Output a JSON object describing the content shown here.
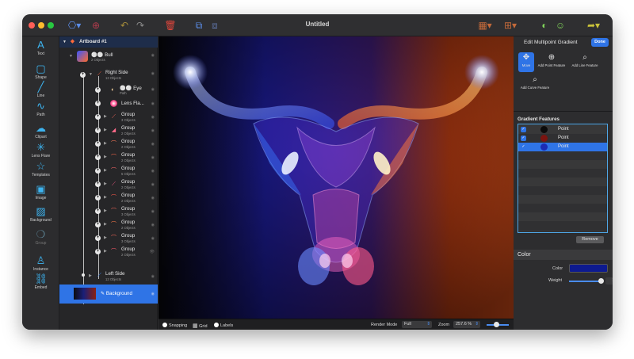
{
  "window": {
    "title": "Untitled"
  },
  "toolbar": {
    "icons": [
      "artboard-icon",
      "target-icon",
      "undo-icon",
      "redo-icon",
      "trash-icon",
      "group-icon",
      "ungroup-icon",
      "grid-icon",
      "hierarchy-icon",
      "palette-icon",
      "color-wheel-icon",
      "share-icon"
    ]
  },
  "tools": [
    {
      "label": "Text",
      "icon": "A"
    },
    {
      "label": "Shape",
      "icon": "▢"
    },
    {
      "label": "Line",
      "icon": "╱"
    },
    {
      "label": "Path",
      "icon": "∿"
    },
    {
      "label": "Clipart",
      "icon": "☁"
    },
    {
      "label": "Lens Flare",
      "icon": "✳"
    },
    {
      "label": "Templates",
      "icon": "☆"
    },
    {
      "label": "Image",
      "icon": "▣"
    },
    {
      "label": "Background",
      "icon": "▨"
    },
    {
      "label": "Group",
      "icon": "❍"
    },
    {
      "label": "Instance",
      "icon": "♙"
    },
    {
      "label": "Embed",
      "icon": "⛓"
    }
  ],
  "layers": {
    "artboard": "Artboard #1",
    "bull": {
      "name": "Bull",
      "sub": "2 Objects"
    },
    "right_side": {
      "name": "Right Side",
      "sub": "13 Objects"
    },
    "eye": {
      "name": "Eye",
      "sub": "Path"
    },
    "lens": {
      "name": "Lens Fla..."
    },
    "groups": [
      {
        "name": "Group",
        "sub": "3 Objects"
      },
      {
        "name": "Group",
        "sub": "2 Objects"
      },
      {
        "name": "Group",
        "sub": "2 Objects"
      },
      {
        "name": "Group",
        "sub": "2 Objects"
      },
      {
        "name": "Group",
        "sub": "5 Objects"
      },
      {
        "name": "Group",
        "sub": "2 Objects"
      },
      {
        "name": "Group",
        "sub": "2 Objects"
      },
      {
        "name": "Group",
        "sub": "3 Objects"
      },
      {
        "name": "Group",
        "sub": "2 Objects"
      },
      {
        "name": "Group",
        "sub": "3 Objects"
      },
      {
        "name": "Group",
        "sub": "2 Objects"
      }
    ],
    "left_side": {
      "name": "Left Side",
      "sub": "13 Objects"
    },
    "background": {
      "name": "Background"
    }
  },
  "status": {
    "snapping": "Snapping",
    "grid": "Grid",
    "labels": "Labels",
    "render_label": "Render Mode",
    "render_value": "Full",
    "zoom_label": "Zoom",
    "zoom_value": "257.6 %"
  },
  "inspector": {
    "title": "Edit Multipoint Gradient",
    "done": "Done",
    "features": [
      {
        "label": "Move",
        "icon": "✥"
      },
      {
        "label": "Add Point Feature",
        "icon": "⊕"
      },
      {
        "label": "Add Line Feature",
        "icon": "⌕"
      },
      {
        "label": "Add Curve Feature",
        "icon": "⌕"
      }
    ],
    "gradient_title": "Gradient Features",
    "points": [
      {
        "label": "Point",
        "color": "#0b0b0b"
      },
      {
        "label": "Point",
        "color": "#7a1410"
      },
      {
        "label": "Point",
        "color": "#1c2cb4"
      }
    ],
    "remove": "Remove",
    "color_section": "Color",
    "color_label": "Color",
    "color_value": "#0d1a8f",
    "weight_label": "Weight",
    "weight_value": "100"
  }
}
